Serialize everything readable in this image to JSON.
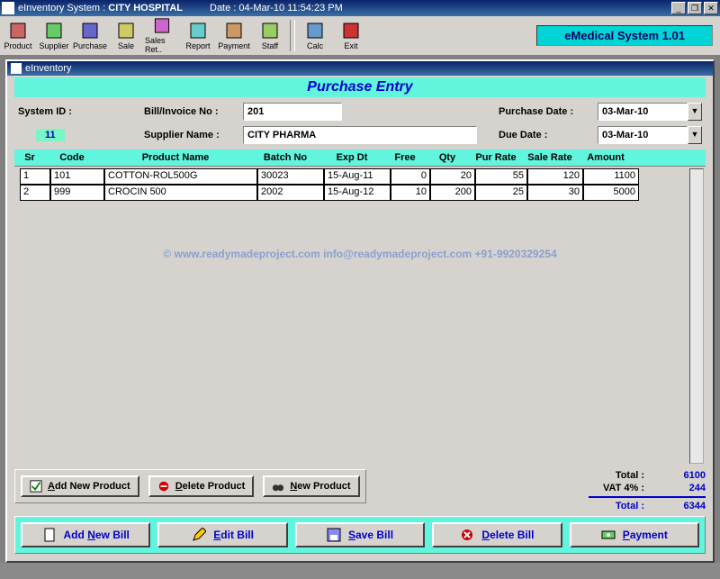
{
  "titlebar": {
    "app": "eInventory System :",
    "context": "CITY HOSPITAL",
    "date_label": "Date :",
    "datetime": "04-Mar-10 11:54:23 PM"
  },
  "toolbar": {
    "items": [
      "Product",
      "Supplier",
      "Purchase",
      "Sale",
      "Sales Ret..",
      "Report",
      "Payment",
      "Staff",
      "Calc",
      "Exit"
    ],
    "brand": "eMedical System 1.01"
  },
  "child": {
    "title": "eInventory"
  },
  "page": {
    "title": "Purchase Entry"
  },
  "form": {
    "system_id_label": "System ID :",
    "system_id": "11",
    "bill_label": "Bill/Invoice No :",
    "bill_value": "201",
    "supplier_label": "Supplier Name :",
    "supplier_value": "CITY PHARMA",
    "purchase_date_label": "Purchase Date :",
    "purchase_date": "03-Mar-10",
    "due_date_label": "Due Date :",
    "due_date": "03-Mar-10"
  },
  "grid": {
    "headers": [
      "Sr",
      "Code",
      "Product Name",
      "Batch No",
      "Exp Dt",
      "Free",
      "Qty",
      "Pur Rate",
      "Sale Rate",
      "Amount"
    ],
    "rows": [
      {
        "sr": "1",
        "code": "101",
        "name": "COTTON-ROL500G",
        "batch": "30023",
        "exp": "15-Aug-11",
        "free": "0",
        "qty": "20",
        "pur": "55",
        "sale": "120",
        "amt": "1100"
      },
      {
        "sr": "2",
        "code": "999",
        "name": "CROCIN 500",
        "batch": "2002",
        "exp": "15-Aug-12",
        "free": "10",
        "qty": "200",
        "pur": "25",
        "sale": "30",
        "amt": "5000"
      }
    ]
  },
  "watermark": "©  www.readymadeproject.com  info@readymadeproject.com  +91-9920329254",
  "midbuttons": {
    "add": "Add New Product",
    "delete": "Delete Product",
    "new": "New Product"
  },
  "totals": {
    "total_label": "Total :",
    "total": "6100",
    "vat_label": "VAT 4% :",
    "vat": "244",
    "grand_label": "Total :",
    "grand": "6344"
  },
  "bottom": {
    "add": "Add New Bill",
    "edit": "Edit Bill",
    "save": "Save Bill",
    "delete": "Delete Bill",
    "payment": "Payment"
  }
}
